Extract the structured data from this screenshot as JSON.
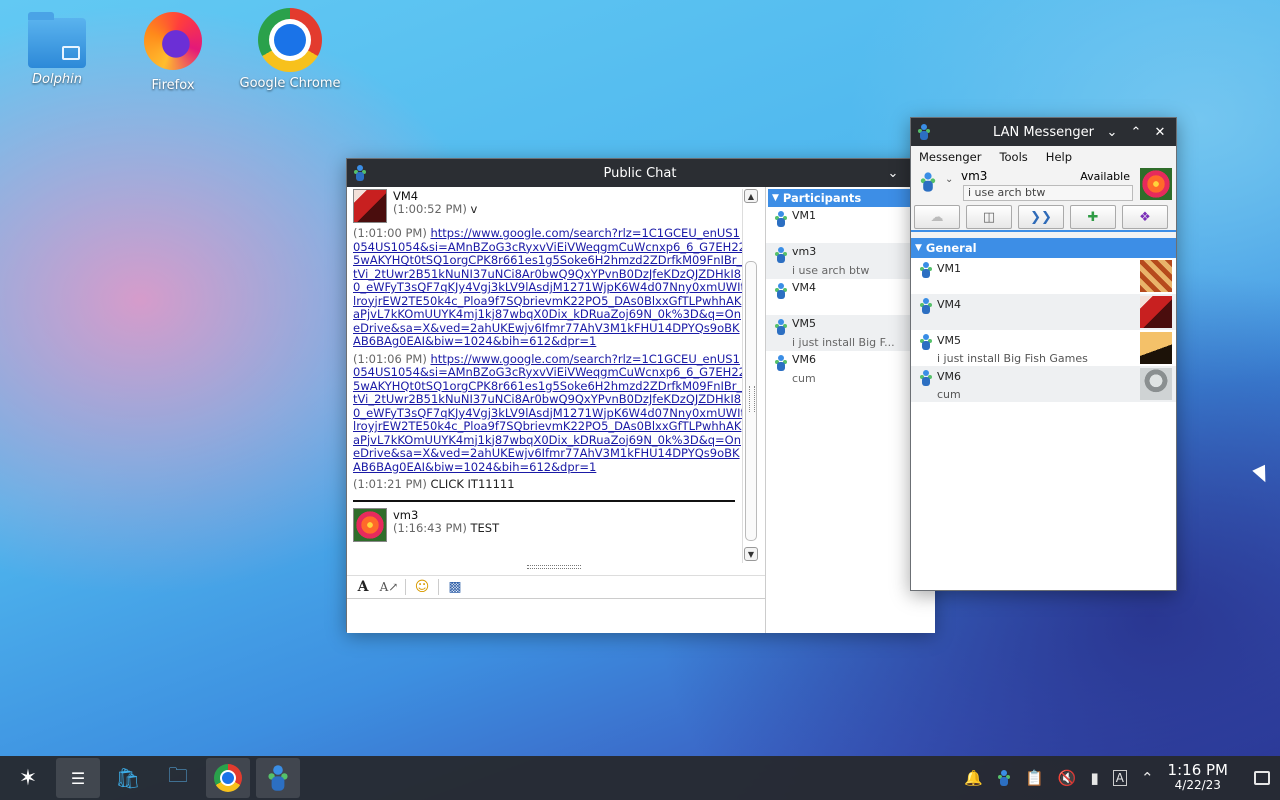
{
  "desktop": {
    "icons": [
      {
        "label": "Dolphin"
      },
      {
        "label": "Firefox"
      },
      {
        "label": "Google Chrome"
      }
    ]
  },
  "public_chat": {
    "title": "Public Chat",
    "messages": [
      {
        "sender": "VM4",
        "time": "(1:00:52 PM)",
        "text": "v"
      },
      {
        "time": "(1:01:00 PM)",
        "link": "https://www.google.com/search?rlz=1C1GCEU_enUS1054US1054&si=AMnBZoG3cRyxvViEiVWeqgmCuWcnxp6_6_G7EH225wAKYHQt0tSQ1orgCPK8r661es1g5Soke6H2hmzd2ZDrfkM09FnIBr_ltVi_2tUwr2B51kNuNI37uNCi8Ar0bwQ9QxYPvnB0DzJfeKDzQJZDHkI80_eWFyT3sQF7qKJy4Vgj3kLV9lAsdjM1271WjpK6W4d07Nny0xmUWItlroyjrEW2TE50k4c_Ploa9f7SQbrievmK22PO5_DAs0BlxxGfTLPwhhAKaPjvL7kKOmUUYK4mj1kj87wbqX0Dix_kDRuaZoj69N_0k%3D&q=OneDrive&sa=X&ved=2ahUKEwjv6Ifmr77AhV3M1kFHU14DPYQs9oBKAB6BAg0EAI&biw=1024&bih=612&dpr=1"
      },
      {
        "time": "(1:01:06 PM)",
        "link": "https://www.google.com/search?rlz=1C1GCEU_enUS1054US1054&si=AMnBZoG3cRyxvViEiVWeqgmCuWcnxp6_6_G7EH225wAKYHQt0tSQ1orgCPK8r661es1g5Soke6H2hmzd2ZDrfkM09FnIBr_ltVi_2tUwr2B51kNuNI37uNCi8Ar0bwQ9QxYPvnB0DzJfeKDzQJZDHkI80_eWFyT3sQF7qKJy4Vgj3kLV9lAsdjM1271WjpK6W4d07Nny0xmUWItlroyjrEW2TE50k4c_Ploa9f7SQbrievmK22PO5_DAs0BlxxGfTLPwhhAKaPjvL7kKOmUUYK4mj1kj87wbqX0Dix_kDRuaZoj69N_0k%3D&q=OneDrive&sa=X&ved=2ahUKEwjv6Ifmr77AhV3M1kFHU14DPYQs9oBKAB6BAg0EAI&biw=1024&bih=612&dpr=1"
      },
      {
        "time": "(1:01:21 PM)",
        "text": "CLICK IT11111"
      },
      {
        "sender": "vm3",
        "time": "(1:16:43 PM)",
        "text": "TEST"
      }
    ],
    "participants_header": "Participants",
    "participants": [
      {
        "name": "VM1",
        "status": ""
      },
      {
        "name": "vm3",
        "status": "i use arch btw"
      },
      {
        "name": "VM4",
        "status": ""
      },
      {
        "name": "VM5",
        "status": "i just install Big F..."
      },
      {
        "name": "VM6",
        "status": "cum"
      }
    ]
  },
  "lan_messenger": {
    "title": "LAN Messenger",
    "menu": [
      "Messenger",
      "Tools",
      "Help"
    ],
    "me": {
      "name": "vm3",
      "availability": "Available",
      "note": "i use arch btw"
    },
    "group": "General",
    "contacts": [
      {
        "name": "VM1",
        "status": ""
      },
      {
        "name": "VM4",
        "status": ""
      },
      {
        "name": "VM5",
        "status": "i just install Big Fish Games"
      },
      {
        "name": "VM6",
        "status": "cum"
      }
    ]
  },
  "taskbar": {
    "clock_time": "1:16 PM",
    "clock_date": "4/22/23"
  }
}
